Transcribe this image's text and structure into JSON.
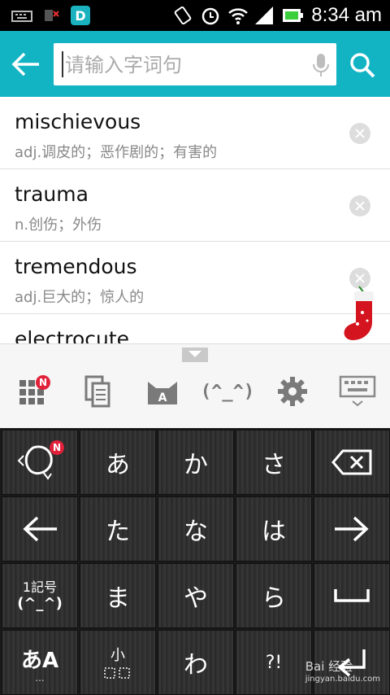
{
  "status_bar": {
    "time": "8:34 am",
    "icons": [
      "keyboard-icon",
      "no-sim-icon",
      "app-d-icon",
      "rotate-icon",
      "alarm-icon",
      "wifi-icon",
      "signal-icon",
      "battery-icon"
    ]
  },
  "header": {
    "back_icon": "arrow-left-icon",
    "search_placeholder": "请输入字词句",
    "search_value": "",
    "mic_icon": "mic-icon",
    "search_icon": "search-icon",
    "accent": "#12b4c4"
  },
  "history": [
    {
      "word": "mischievous",
      "definition": "adj.调皮的；恶作剧的；有害的"
    },
    {
      "word": "trauma",
      "definition": "n.创伤；外伤"
    },
    {
      "word": "tremendous",
      "definition": "adj.巨大的；惊人的"
    },
    {
      "word": "electrocute",
      "definition": ""
    }
  ],
  "ime_toolbar": {
    "badge": "N",
    "items": [
      "menu-grid-icon",
      "clipboard-icon",
      "cat-face-icon",
      "emoticon-icon",
      "settings-icon",
      "keyboard-hide-icon"
    ],
    "emoticon_label": "(^_^)",
    "cat_label": "A"
  },
  "keyboard": {
    "rows": [
      [
        "",
        "あ",
        "か",
        "さ",
        ""
      ],
      [
        "",
        "た",
        "な",
        "は",
        ""
      ],
      [
        "",
        "ま",
        "や",
        "ら",
        ""
      ],
      [
        "",
        "",
        "わ",
        "",
        ""
      ]
    ],
    "badge": "N",
    "symbol_key": {
      "line1": "1記号",
      "line2": "(^_^)"
    },
    "kana_key": {
      "line1": "あA",
      "line2": "..."
    },
    "small_key": "小",
    "punct_key": "?!"
  },
  "watermark": {
    "brand": "Bai 经验",
    "url": "jingyan.baidu.com"
  }
}
